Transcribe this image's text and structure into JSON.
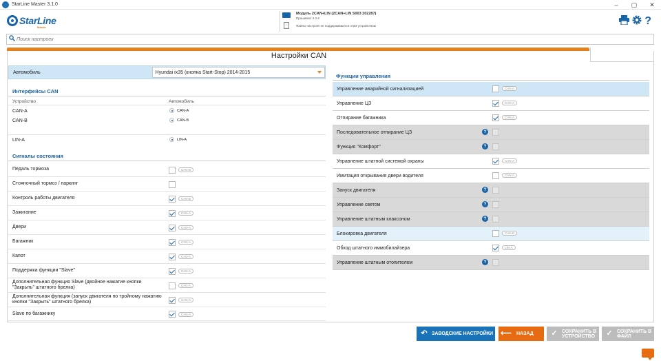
{
  "window": {
    "title": "StarLine Master 3.1.0",
    "controls": [
      "–",
      "▢",
      "✕"
    ]
  },
  "header": {
    "logo_text": "StarLine",
    "logo_sub": "Master",
    "module_line": "Модуль 2CAN+LIN (2CAN+LIN S003 202287)",
    "firmware_line": "Прошивка: 3.2.6",
    "settings_file_line": "Файлы настроек не поддерживаются этим устройством",
    "icons": [
      "printer-icon",
      "gear-icon",
      "help-icon"
    ]
  },
  "search": {
    "placeholder": "Поиск настроек"
  },
  "page": {
    "title": "Настройки CAN"
  },
  "left": {
    "auto_label": "Автомобиль",
    "auto_value": "Hyundai ix35 (кнопка Start-Stop) 2014-2015",
    "interfaces_title": "Интерфейсы CAN",
    "col_device": "Устройство",
    "col_car": "Автомобиль",
    "interfaces": [
      {
        "device": "CAN-A",
        "car": "CAN-A"
      },
      {
        "device": "CAN-B",
        "car": "CAN-B"
      },
      {
        "device": "LIN-A",
        "car": "LIN-A"
      }
    ],
    "signals_title": "Сигналы состояния",
    "signals": [
      {
        "label": "Педаль тормоза",
        "checked": false,
        "tag": "CAN-B"
      },
      {
        "label": "Стояночный тормоз / паркинг",
        "checked": false,
        "tag": ""
      },
      {
        "label": "Контроль работы двигателя",
        "checked": true,
        "tag": "CAN-B"
      },
      {
        "label": "Зажигание",
        "checked": true,
        "tag": "CAN-A"
      },
      {
        "label": "Двери",
        "checked": true,
        "tag": "CAN-A"
      },
      {
        "label": "Багажник",
        "checked": true,
        "tag": "CAN-A"
      },
      {
        "label": "Капот",
        "checked": true,
        "tag": "CAN-A"
      },
      {
        "label": "Поддержка функции \"Slave\"",
        "checked": true,
        "tag": "CAN-A"
      },
      {
        "label": "Дополнительная функция Slave (двойное нажатие кнопки \"Закрыть\" штатного брелка)",
        "checked": false,
        "tag": "CAN-A"
      },
      {
        "label": "Дополнительная функция (запуск двигателя по тройному нажатию кнопки \"Закрыть\" штатного брелка)",
        "checked": true,
        "tag": "CAN-A"
      },
      {
        "label": "Slave по багажнику",
        "checked": true,
        "tag": "CAN-A"
      }
    ]
  },
  "right": {
    "title": "Функции управления",
    "functions": [
      {
        "label": "Управление аварийной сигнализацией",
        "checked": false,
        "tag": "CAN-A",
        "state": "selected",
        "help": false
      },
      {
        "label": "Управление ЦЗ",
        "checked": true,
        "tag": "CAN-A",
        "state": "normal",
        "help": false
      },
      {
        "label": "Отпирание багажника",
        "checked": true,
        "tag": "CAN-A",
        "state": "normal",
        "help": false
      },
      {
        "label": "Последовательное отпирание ЦЗ",
        "checked": false,
        "tag": "",
        "state": "disabled",
        "help": true
      },
      {
        "label": "Функция \"Комфорт\"",
        "checked": false,
        "tag": "",
        "state": "disabled",
        "help": true
      },
      {
        "label": "Управление штатной системой охраны",
        "checked": true,
        "tag": "CAN-A",
        "state": "normal",
        "help": false
      },
      {
        "label": "Имитация открывания двери водителя",
        "checked": false,
        "tag": "CAN-A",
        "state": "normal",
        "help": false
      },
      {
        "label": "Запуск двигателя",
        "checked": false,
        "tag": "",
        "state": "disabled",
        "help": true
      },
      {
        "label": "Управление светом",
        "checked": false,
        "tag": "",
        "state": "disabled",
        "help": true
      },
      {
        "label": "Управление штатным клаксоном",
        "checked": false,
        "tag": "",
        "state": "disabled",
        "help": true
      },
      {
        "label": "Блокировка двигателя",
        "checked": false,
        "tag": "CAN-B",
        "state": "highlight",
        "help": false
      },
      {
        "label": "Обход штатного иммобилайзера",
        "checked": true,
        "tag": "LIN-A",
        "state": "normal",
        "help": false
      },
      {
        "label": "Управление штатным отопителем",
        "checked": false,
        "tag": "",
        "state": "disabled",
        "help": true
      }
    ]
  },
  "buttons": {
    "factory": "ЗАВОДСКИЕ НАСТРОЙКИ",
    "back": "НАЗАД",
    "save_device_1": "СОХРАНИТЬ В",
    "save_device_2": "УСТРОЙСТВО",
    "save_file_1": "СОХРАНИТЬ В",
    "save_file_2": "ФАЙЛ"
  },
  "colors": {
    "accent": "#1a64a8",
    "orange": "#e5811c",
    "selected_row": "#cfe6f6",
    "disabled_row": "#d9d9d9",
    "button_blue": "#1a72b8",
    "button_orange": "#e66b13",
    "button_gray": "#b8b8b8"
  }
}
